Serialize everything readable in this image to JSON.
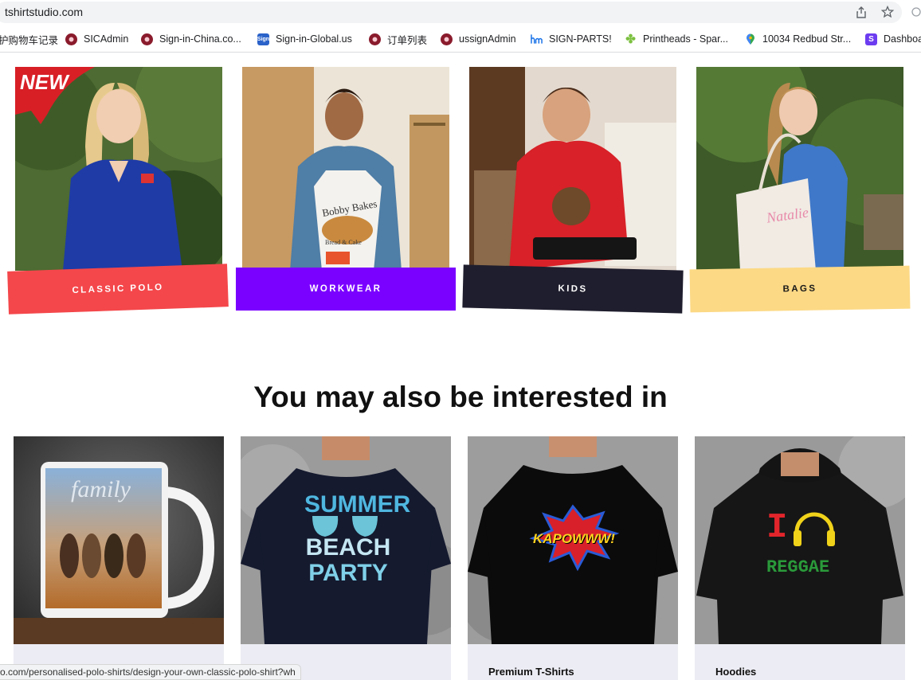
{
  "browser": {
    "url": "tshirtstudio.com",
    "bookmarks": [
      {
        "label": "护购物车记录",
        "icon": "none"
      },
      {
        "label": "SICAdmin",
        "icon": "rose-icon"
      },
      {
        "label": "Sign-in-China.co...",
        "icon": "rose-icon"
      },
      {
        "label": "Sign-in-Global.us",
        "icon": "sign-icon"
      },
      {
        "label": "订单列表",
        "icon": "rose-icon"
      },
      {
        "label": "ussignAdmin",
        "icon": "rose-icon"
      },
      {
        "label": "SIGN-PARTS!",
        "icon": "hm-logo-icon"
      },
      {
        "label": "Printheads - Spar...",
        "icon": "clover-icon"
      },
      {
        "label": "10034 Redbud Str...",
        "icon": "map-pin-icon"
      },
      {
        "label": "Dashboa",
        "icon": "s-square-icon"
      }
    ],
    "sign_badge": "Sign",
    "s_badge": "S"
  },
  "categories": [
    {
      "label": "CLASSIC POLO",
      "badge": "NEW",
      "bg": "#f4474b",
      "color": "#ffffff"
    },
    {
      "label": "WORKWEAR",
      "bg": "#7a00ff",
      "color": "#ffffff"
    },
    {
      "label": "KIDS",
      "bg": "#1f1e2e",
      "color": "#ffffff"
    },
    {
      "label": "BAGS",
      "bg": "#fcd985",
      "color": "#1a1a1a"
    }
  ],
  "apron_text": {
    "line1": "Bobby Bakes",
    "line2": "Bread & Cake"
  },
  "bag_text": "Natalie",
  "section_heading": "You may also be interested in",
  "products": [
    {
      "name": "",
      "art": "family"
    },
    {
      "name": "",
      "art": "SUMMER BEACH PARTY"
    },
    {
      "name": "Premium T-Shirts",
      "art": "KAPOWWW!"
    },
    {
      "name": "Hoodies",
      "art": "REGGAE"
    }
  ],
  "product_art": {
    "mug": "family",
    "summer": [
      "SUMMER",
      "BEACH",
      "PARTY"
    ],
    "kapow": "KAPOWWW!",
    "reggae_i": "I",
    "reggae": "REGGAE"
  },
  "status_bar": "o.com/personalised-polo-shirts/design-your-own-classic-polo-shirt?wh"
}
